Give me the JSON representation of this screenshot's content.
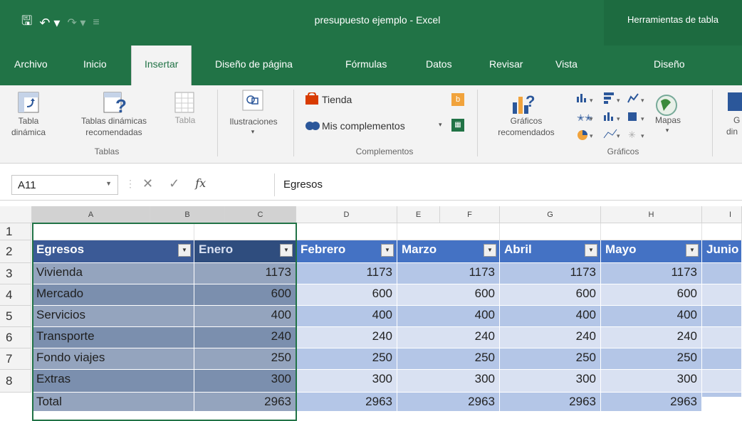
{
  "titlebar": {
    "document_title": "presupuesto ejemplo  -  Excel",
    "tools_title": "Herramientas de tabla"
  },
  "tabs": [
    {
      "label": "Archivo"
    },
    {
      "label": "Inicio"
    },
    {
      "label": "Insertar",
      "active": true
    },
    {
      "label": "Diseño de página"
    },
    {
      "label": "Fórmulas"
    },
    {
      "label": "Datos"
    },
    {
      "label": "Revisar"
    },
    {
      "label": "Vista"
    },
    {
      "label": "Diseño"
    }
  ],
  "ribbon": {
    "pivot_table": "Tabla\ndinámica",
    "recommended_pivot": "Tablas dinámicas\nrecomendadas",
    "table": "Tabla",
    "group_tables": "Tablas",
    "illustrations": "Ilustraciones",
    "store": "Tienda",
    "my_addins": "Mis complementos",
    "group_addins": "Complementos",
    "recommended_charts": "Gráficos\nrecomendados",
    "maps": "Mapas",
    "group_charts": "Gráficos",
    "cut_g": "G",
    "cut_din": "din"
  },
  "formula_bar": {
    "name_box": "A11",
    "fx": "fx",
    "value": "Egresos"
  },
  "columns": [
    "A",
    "B",
    "C",
    "D",
    "E",
    "F",
    "G",
    "H",
    "I"
  ],
  "rows": [
    "1",
    "2",
    "3",
    "4",
    "5",
    "6",
    "7",
    "8"
  ],
  "table": {
    "headers": [
      "Egresos",
      "Enero",
      "Febrero",
      "Marzo",
      "Abril",
      "Mayo",
      "Junio"
    ],
    "body": [
      [
        "Vivienda",
        "1173",
        "1173",
        "1173",
        "1173",
        "1173"
      ],
      [
        "Mercado",
        "600",
        "600",
        "600",
        "600",
        "600"
      ],
      [
        "Servicios",
        "400",
        "400",
        "400",
        "400",
        "400"
      ],
      [
        "Transporte",
        "240",
        "240",
        "240",
        "240",
        "240"
      ],
      [
        "Fondo viajes",
        "250",
        "250",
        "250",
        "250",
        "250"
      ],
      [
        "Extras",
        "300",
        "300",
        "300",
        "300",
        "300"
      ],
      [
        "Total",
        "2963",
        "2963",
        "2963",
        "2963",
        "2963"
      ]
    ]
  },
  "colors": {
    "excel_green": "#217346",
    "table_header": "#4472c4",
    "band_light": "#d9e1f2",
    "band_dark": "#b4c6e7"
  }
}
